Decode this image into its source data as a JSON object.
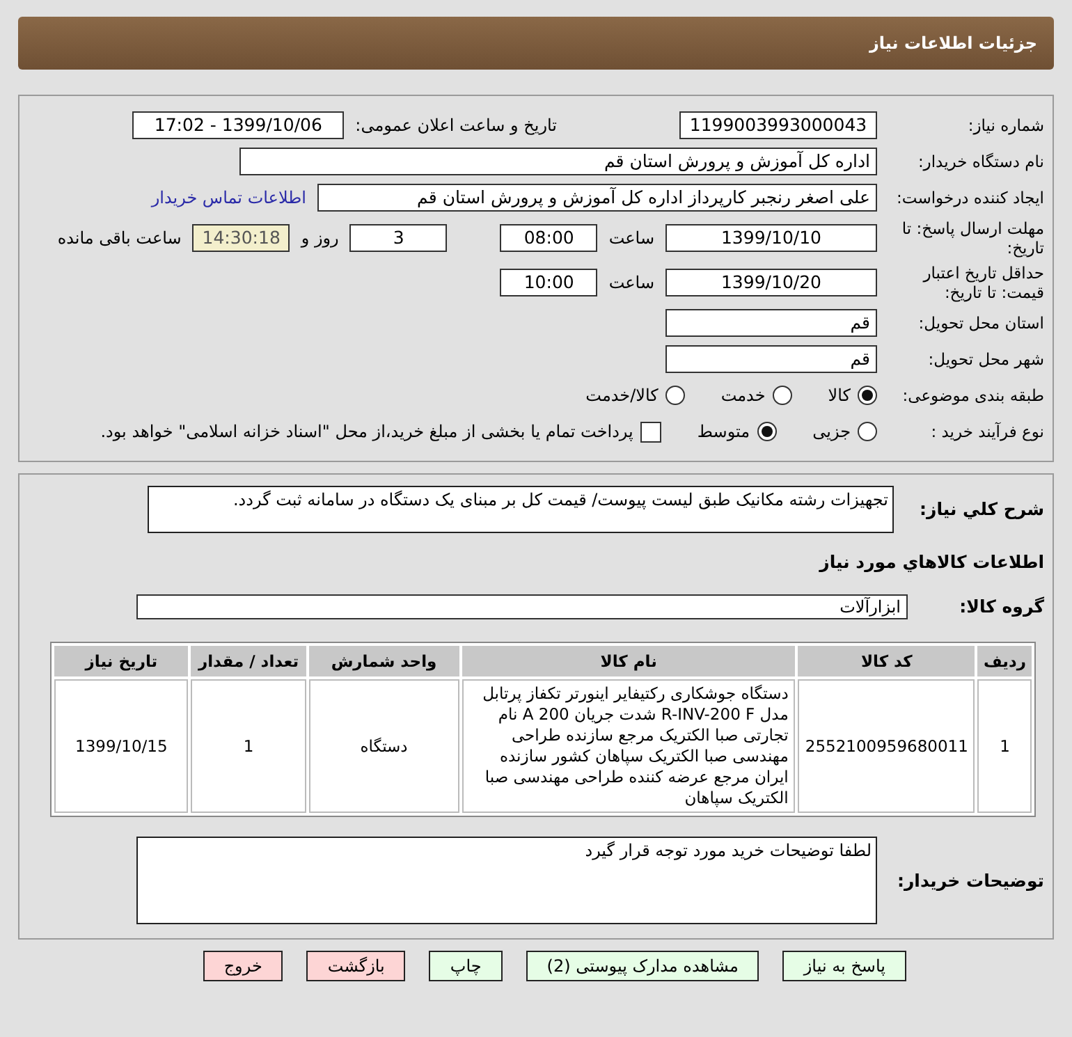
{
  "header": {
    "title": "جزئیات اطلاعات نیاز"
  },
  "need": {
    "number_label": "شماره نیاز:",
    "number": "1199003993000043",
    "announce_label": "تاریخ و ساعت اعلان عمومی:",
    "announce": "1399/10/06 - 17:02"
  },
  "buyer": {
    "label": "نام دستگاه خریدار:",
    "value": "اداره کل آموزش و پرورش استان قم"
  },
  "creator": {
    "label": "ایجاد کننده درخواست:",
    "value": "علی اصغر رنجبر کارپرداز اداره کل آموزش و پرورش استان قم",
    "contact_link": "اطلاعات تماس خریدار"
  },
  "reply_deadline": {
    "label": "مهلت ارسال پاسخ: تا تاریخ:",
    "date": "1399/10/10",
    "time_label": "ساعت",
    "time": "08:00",
    "days": "3",
    "days_label": "روز و",
    "remaining": "14:30:18",
    "remaining_label": "ساعت باقی مانده"
  },
  "validity": {
    "label": "حداقل تاریخ اعتبار قیمت: تا تاریخ:",
    "date": "1399/10/20",
    "time_label": "ساعت",
    "time": "10:00"
  },
  "province": {
    "label": "استان محل تحویل:",
    "value": "قم"
  },
  "city": {
    "label": "شهر محل تحویل:",
    "value": "قم"
  },
  "category": {
    "label": "طبقه بندی موضوعی:",
    "options": [
      {
        "label": "کالا",
        "selected": true
      },
      {
        "label": "خدمت",
        "selected": false
      },
      {
        "label": "کالا/خدمت",
        "selected": false
      }
    ]
  },
  "purchase_type": {
    "label": "نوع فرآیند خرید :",
    "options": [
      {
        "label": "جزیی",
        "selected": false
      },
      {
        "label": "متوسط",
        "selected": true
      }
    ],
    "treasury": {
      "label": "پرداخت تمام یا بخشی از مبلغ خرید،از محل \"اسناد خزانه اسلامی\" خواهد بود.",
      "checked": false
    }
  },
  "description": {
    "label": "شرح كلي نياز:",
    "value": "تجهیزات رشته مکانیک طبق لیست پیوست/ قیمت کل بر مبنای یک دستگاه در سامانه ثبت گردد."
  },
  "goods_title": "اطلاعات كالاهاي مورد نياز",
  "goods_group": {
    "label": "گروه کالا:",
    "value": "ابزارآلات"
  },
  "table": {
    "columns": [
      "ردیف",
      "کد کالا",
      "نام کالا",
      "واحد شمارش",
      "تعداد / مقدار",
      "تاریخ نیاز"
    ],
    "rows": [
      [
        "1",
        "2552100959680011",
        "دستگاه جوشکاری رکتیفایر اینورتر تکفاز پرتابل مدل R-INV-200 F شدت جریان 200 A نام تجارتی صبا الکتریک مرجع سازنده طراحی مهندسی صبا الکتریک سپاهان کشور سازنده ایران مرجع عرضه کننده طراحی مهندسی صبا الکتریک سپاهان",
        "دستگاه",
        "1",
        "1399/10/15"
      ]
    ]
  },
  "buyer_notes": {
    "label": "توضیحات خریدار:",
    "value": "لطفا توضیحات خرید مورد توجه قرار گیرد"
  },
  "buttons": [
    {
      "label": "پاسخ به نیاز",
      "kind": "normal"
    },
    {
      "label": "مشاهده مدارک پیوستی (2)",
      "kind": "normal"
    },
    {
      "label": "چاپ",
      "kind": "normal"
    },
    {
      "label": "بازگشت",
      "kind": "danger"
    },
    {
      "label": "خروج",
      "kind": "danger"
    }
  ]
}
